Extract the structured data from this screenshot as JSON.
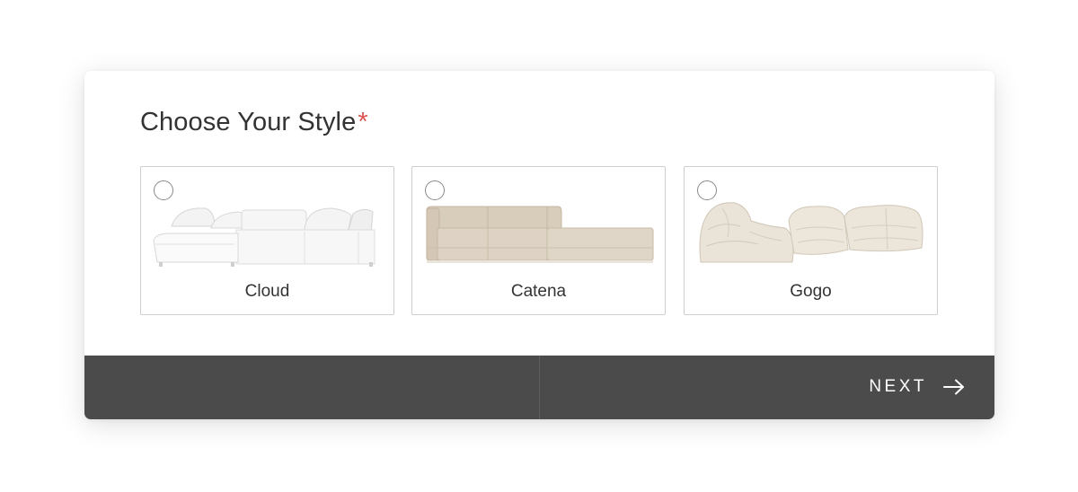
{
  "form": {
    "title": "Choose Your Style",
    "required_mark": "*",
    "colors": {
      "required": "#d9534f",
      "footer_bg": "#4b4b4b",
      "text": "#333333"
    }
  },
  "options": [
    {
      "label": "Cloud",
      "selected": false,
      "image": "white-modular-sectional-sofa"
    },
    {
      "label": "Catena",
      "selected": false,
      "image": "beige-low-sectional-sofa"
    },
    {
      "label": "Gogo",
      "selected": false,
      "image": "cream-lounge-chair-sofa-set"
    }
  ],
  "footer": {
    "next_label": "NEXT",
    "next_icon": "arrow-right-icon"
  }
}
